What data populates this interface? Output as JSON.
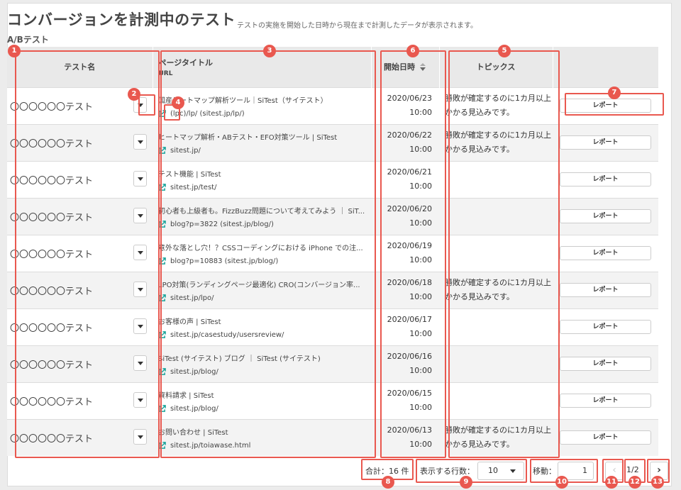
{
  "header": {
    "title": "コンバージョンを計測中のテスト",
    "description": "テストの実施を開始した日時から現在まで計測したデータが表示されます。",
    "subtitle": "A/Bテスト"
  },
  "table": {
    "columns": {
      "name": "テスト名",
      "page_title": "ページタイトル",
      "url": "URL",
      "start_date": "開始日時",
      "topics": "トピックス"
    },
    "rows": [
      {
        "name": "〇〇〇〇〇〇テスト",
        "title": "国産ヒートマップ解析ツール｜SiTest（サイテスト）",
        "url": "(lpc)/lp/ (sitest.jp/lp/)",
        "date": "2020/06/23",
        "time": "10:00",
        "topic": "勝敗が確定するのに1カ月以上かかる見込みです。",
        "report": "レポート"
      },
      {
        "name": "〇〇〇〇〇〇テスト",
        "title": "ヒートマップ解析・ABテスト・EFO対策ツール | SiTest",
        "url": "sitest.jp/",
        "date": "2020/06/22",
        "time": "10:00",
        "topic": "勝敗が確定するのに1カ月以上かかる見込みです。",
        "report": "レポート"
      },
      {
        "name": "〇〇〇〇〇〇テスト",
        "title": "テスト機能 | SiTest",
        "url": "sitest.jp/test/",
        "date": "2020/06/21",
        "time": "10:00",
        "topic": "",
        "report": "レポート"
      },
      {
        "name": "〇〇〇〇〇〇テスト",
        "title": "初心者も上級者も。FizzBuzz問題について考えてみよう ｜ SiT...",
        "url": "blog?p=3822 (sitest.jp/blog/)",
        "date": "2020/06/20",
        "time": "10:00",
        "topic": "",
        "report": "レポート"
      },
      {
        "name": "〇〇〇〇〇〇テスト",
        "title": "意外な落とし穴！？CSSコーディングにおける iPhone での注...",
        "url": "blog?p=10883 (sitest.jp/blog/)",
        "date": "2020/06/19",
        "time": "10:00",
        "topic": "",
        "report": "レポート"
      },
      {
        "name": "〇〇〇〇〇〇テスト",
        "title": "LPO対策(ランディングページ最適化) CRO(コンバージョン率...",
        "url": "sitest.jp/lpo/",
        "date": "2020/06/18",
        "time": "10:00",
        "topic": "勝敗が確定するのに1カ月以上かかる見込みです。",
        "report": "レポート"
      },
      {
        "name": "〇〇〇〇〇〇テスト",
        "title": "お客様の声 | SiTest",
        "url": "sitest.jp/casestudy/usersreview/",
        "date": "2020/06/17",
        "time": "10:00",
        "topic": "",
        "report": "レポート"
      },
      {
        "name": "〇〇〇〇〇〇テスト",
        "title": "SiTest (サイテスト) ブログ ｜ SiTest (サイテスト)",
        "url": "sitest.jp/blog/",
        "date": "2020/06/16",
        "time": "10:00",
        "topic": "",
        "report": "レポート"
      },
      {
        "name": "〇〇〇〇〇〇テスト",
        "title": "資料請求 | SiTest",
        "url": "sitest.jp/blog/",
        "date": "2020/06/15",
        "time": "10:00",
        "topic": "",
        "report": "レポート"
      },
      {
        "name": "〇〇〇〇〇〇テスト",
        "title": "お問い合わせ | SiTest",
        "url": "sitest.jp/toiawase.html",
        "date": "2020/06/13",
        "time": "10:00",
        "topic": "勝敗が確定するのに1カ月以上かかる見込みです。",
        "report": "レポート"
      }
    ]
  },
  "footer": {
    "total": "合計：16 件",
    "rows_label": "表示する行数：",
    "rows_value": "10",
    "move_label": "移動：",
    "move_value": "1",
    "page_info": "1/2",
    "prev_symbol": "‹",
    "next_symbol": "›"
  },
  "annotations": [
    "1",
    "2",
    "3",
    "4",
    "5",
    "6",
    "7",
    "8",
    "9",
    "10",
    "11",
    "12",
    "13"
  ],
  "colors": {
    "annotation": "#e9584f",
    "icon": "#1aa39a",
    "header_bg": "#e9e9e9"
  }
}
